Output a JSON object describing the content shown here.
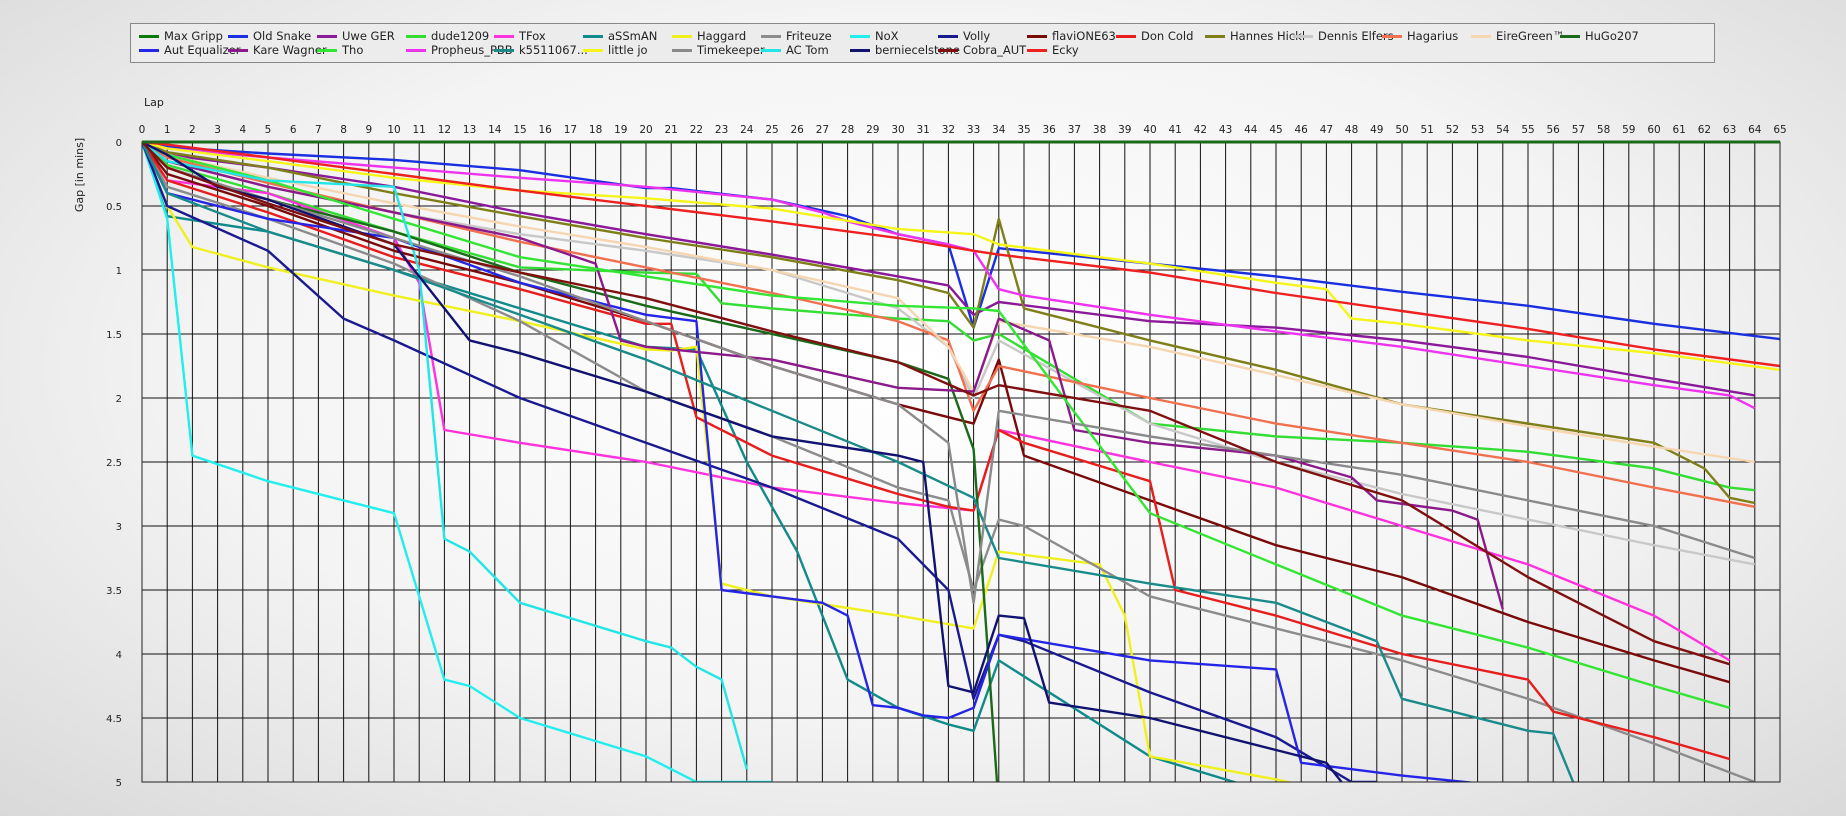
{
  "chart_data": {
    "type": "line",
    "title": "",
    "xlabel": "Lap",
    "ylabel": "Gap [in mins]",
    "xlim": [
      0,
      65
    ],
    "ylim": [
      0,
      5
    ],
    "y_inverted": true,
    "grid": true,
    "legend_position": "top",
    "x_ticks": [
      0,
      1,
      2,
      3,
      4,
      5,
      6,
      7,
      8,
      9,
      10,
      11,
      12,
      13,
      14,
      15,
      16,
      17,
      18,
      19,
      20,
      21,
      22,
      23,
      24,
      25,
      26,
      27,
      28,
      29,
      30,
      31,
      32,
      33,
      34,
      35,
      36,
      37,
      38,
      39,
      40,
      41,
      42,
      43,
      44,
      45,
      46,
      47,
      48,
      49,
      50,
      51,
      52,
      53,
      54,
      55,
      56,
      57,
      58,
      59,
      60,
      61,
      62,
      63,
      64,
      65
    ],
    "y_ticks": [
      0,
      0.5,
      1,
      1.5,
      2,
      2.5,
      3,
      3.5,
      4,
      4.5,
      5
    ],
    "y_tick_labels": [
      "0",
      "0.5",
      "1",
      "1.5",
      "2",
      "2.5",
      "3",
      "3.5",
      "4",
      "4.5",
      "5"
    ],
    "series": [
      {
        "name": "Max Gripp",
        "color": "#0a7a0a",
        "x": [
          0,
          65
        ],
        "y": [
          0,
          0
        ]
      },
      {
        "name": "Old Snake",
        "color": "#1a2fe0",
        "x": [
          0,
          1,
          5,
          10,
          15,
          20,
          21,
          25,
          28,
          30,
          32,
          33,
          34,
          40,
          45,
          50,
          55,
          60,
          65
        ],
        "y": [
          0,
          0.04,
          0.09,
          0.14,
          0.22,
          0.36,
          0.36,
          0.45,
          0.58,
          0.72,
          0.8,
          1.45,
          0.83,
          0.95,
          1.05,
          1.17,
          1.28,
          1.42,
          1.54
        ]
      },
      {
        "name": "Uwe GER",
        "color": "#8b1a9a",
        "x": [
          0,
          1,
          5,
          10,
          15,
          20,
          25,
          30,
          32,
          33,
          34,
          40,
          45,
          50,
          55,
          60,
          64
        ],
        "y": [
          0,
          0.1,
          0.2,
          0.35,
          0.55,
          0.72,
          0.88,
          1.05,
          1.12,
          1.35,
          1.25,
          1.4,
          1.45,
          1.55,
          1.68,
          1.85,
          1.98
        ]
      },
      {
        "name": "dude1209",
        "color": "#33dd33",
        "x": [
          0,
          1,
          5,
          10,
          15,
          20,
          22,
          23,
          25,
          30,
          32,
          33,
          34,
          40,
          45,
          50,
          55,
          60,
          63,
          64
        ],
        "y": [
          0,
          0.18,
          0.4,
          0.7,
          0.98,
          1.02,
          1.03,
          1.26,
          1.3,
          1.38,
          1.4,
          1.55,
          1.5,
          2.2,
          2.3,
          2.35,
          2.42,
          2.55,
          2.7,
          2.72
        ]
      },
      {
        "name": "TFox",
        "color": "#ff33dd",
        "x": [
          0,
          1,
          5,
          10,
          11,
          12,
          15,
          20,
          25,
          30,
          33,
          34,
          40,
          45,
          50,
          55,
          60,
          63
        ],
        "y": [
          0,
          0.3,
          0.4,
          0.75,
          1.1,
          2.25,
          2.35,
          2.5,
          2.7,
          2.82,
          2.88,
          2.25,
          2.5,
          2.7,
          3.0,
          3.3,
          3.7,
          4.05
        ]
      },
      {
        "name": "aSSmAN",
        "color": "#108a8a",
        "x": [
          0,
          1,
          5,
          10,
          15,
          20,
          22,
          24,
          26,
          28,
          30,
          32,
          33,
          34,
          40,
          45,
          48,
          49,
          50,
          55,
          56,
          57,
          58
        ],
        "y": [
          0,
          0.58,
          0.7,
          1.0,
          1.3,
          1.6,
          1.62,
          2.5,
          3.2,
          4.2,
          4.42,
          4.55,
          4.6,
          4.05,
          4.8,
          5.1,
          5.2,
          5.2,
          5.2,
          5.2,
          5.2,
          5.2,
          5.2
        ]
      },
      {
        "name": "Haggard",
        "color": "#f0f020",
        "x": [
          0,
          1,
          2,
          5,
          10,
          15,
          20,
          21,
          22,
          23,
          25,
          30,
          33,
          34,
          38,
          39,
          40,
          45,
          50
        ],
        "y": [
          0,
          0.5,
          0.82,
          0.98,
          1.2,
          1.4,
          1.62,
          1.63,
          1.6,
          3.45,
          3.55,
          3.7,
          3.8,
          3.2,
          3.3,
          3.7,
          4.8,
          4.98,
          5.2
        ]
      },
      {
        "name": "Friteuze",
        "color": "#8c8c8c",
        "x": [
          0,
          1,
          5,
          10,
          15,
          20,
          25,
          30,
          32,
          33,
          34,
          35,
          40,
          45,
          50,
          55,
          60,
          64
        ],
        "y": [
          0,
          0.35,
          0.6,
          0.95,
          1.4,
          1.95,
          2.3,
          2.7,
          2.8,
          3.5,
          2.95,
          3.0,
          3.55,
          3.8,
          4.05,
          4.35,
          4.7,
          5.0
        ]
      },
      {
        "name": "NoX",
        "color": "#22eeee",
        "x": [
          0,
          1,
          2,
          5,
          10,
          12,
          13,
          15,
          20,
          22,
          23,
          24,
          25
        ],
        "y": [
          0,
          0.6,
          2.45,
          2.65,
          2.9,
          4.2,
          4.25,
          4.5,
          4.8,
          5.0,
          5.0,
          5.0,
          5.0
        ]
      },
      {
        "name": "Volly",
        "color": "#1a1a90",
        "x": [
          0,
          1,
          5,
          8,
          10,
          15,
          20,
          25,
          30,
          32,
          33,
          34,
          35,
          40,
          45,
          48,
          49
        ],
        "y": [
          0,
          0.5,
          0.85,
          1.38,
          1.55,
          2.0,
          2.35,
          2.7,
          3.1,
          3.5,
          4.35,
          3.85,
          3.9,
          4.3,
          4.65,
          5.0,
          5.0
        ]
      },
      {
        "name": "flaviONE63",
        "color": "#7a0a0a",
        "x": [
          0,
          1,
          5,
          10,
          15,
          20,
          25,
          30,
          33,
          34,
          35,
          40,
          45,
          50,
          55,
          60,
          63
        ],
        "y": [
          0,
          0.25,
          0.5,
          0.85,
          1.1,
          1.4,
          1.75,
          2.05,
          2.2,
          1.7,
          2.45,
          2.8,
          3.15,
          3.4,
          3.75,
          4.05,
          4.22
        ]
      },
      {
        "name": "Don Cold",
        "color": "#e61e1e",
        "x": [
          0,
          1,
          5,
          10,
          15,
          20,
          21,
          22,
          25,
          30,
          32,
          33,
          34,
          35,
          40,
          41,
          45,
          50,
          55,
          56,
          60,
          63
        ],
        "y": [
          0,
          0.3,
          0.55,
          0.9,
          1.15,
          1.42,
          1.42,
          2.15,
          2.45,
          2.75,
          2.85,
          2.88,
          2.25,
          2.35,
          2.65,
          3.5,
          3.7,
          4.0,
          4.2,
          4.45,
          4.65,
          4.82
        ]
      },
      {
        "name": "Hannes Hickl",
        "color": "#7f7f1a",
        "x": [
          0,
          1,
          5,
          10,
          15,
          20,
          25,
          30,
          32,
          33,
          34,
          35,
          40,
          45,
          50,
          55,
          60,
          62,
          63,
          64
        ],
        "y": [
          0,
          0.08,
          0.2,
          0.4,
          0.58,
          0.75,
          0.9,
          1.08,
          1.18,
          1.45,
          0.6,
          1.3,
          1.55,
          1.78,
          2.05,
          2.2,
          2.35,
          2.55,
          2.78,
          2.82
        ]
      },
      {
        "name": "Dennis Elfers",
        "color": "#c8c8c8",
        "x": [
          0,
          1,
          5,
          10,
          15,
          20,
          25,
          30,
          32,
          33,
          34,
          40,
          45,
          50,
          55,
          60,
          64
        ],
        "y": [
          0,
          0.15,
          0.35,
          0.55,
          0.72,
          0.85,
          1.0,
          1.3,
          1.6,
          2.0,
          1.55,
          2.2,
          2.5,
          2.75,
          2.95,
          3.15,
          3.3
        ]
      },
      {
        "name": "Hagarius",
        "color": "#f07050",
        "x": [
          0,
          1,
          5,
          10,
          15,
          20,
          25,
          30,
          32,
          33,
          34,
          40,
          45,
          50,
          55,
          60,
          64
        ],
        "y": [
          0,
          0.12,
          0.32,
          0.55,
          0.78,
          0.98,
          1.18,
          1.4,
          1.55,
          2.1,
          1.75,
          2.0,
          2.2,
          2.35,
          2.5,
          2.7,
          2.85
        ]
      },
      {
        "name": "EireGreen™",
        "color": "#f5d6b0",
        "x": [
          0,
          1,
          5,
          10,
          15,
          20,
          25,
          30,
          32,
          33,
          34,
          40,
          45,
          50,
          55,
          60,
          64
        ],
        "y": [
          0,
          0.1,
          0.28,
          0.48,
          0.66,
          0.82,
          1.0,
          1.22,
          1.6,
          1.95,
          1.4,
          1.6,
          1.82,
          2.05,
          2.22,
          2.38,
          2.5
        ]
      },
      {
        "name": "HuGo207",
        "color": "#1a6a1a",
        "x": [
          0,
          1,
          5,
          10,
          15,
          20,
          25,
          30,
          32,
          33,
          34
        ],
        "y": [
          0,
          0.2,
          0.45,
          0.7,
          1.02,
          1.28,
          1.5,
          1.72,
          1.85,
          2.4,
          5.2
        ]
      },
      {
        "name": "Aut Equalizer",
        "color": "#2525e6",
        "x": [
          0,
          1,
          5,
          10,
          15,
          20,
          22,
          23,
          25,
          27,
          28,
          29,
          30,
          31,
          32,
          33,
          34,
          40,
          45,
          46,
          50,
          55
        ],
        "y": [
          0,
          0.4,
          0.6,
          0.75,
          1.1,
          1.35,
          1.4,
          3.5,
          3.55,
          3.6,
          3.7,
          4.4,
          4.42,
          4.48,
          4.5,
          4.42,
          3.85,
          4.05,
          4.12,
          4.85,
          4.95,
          5.05
        ]
      },
      {
        "name": "Kare Wagner",
        "color": "#8b1a8b",
        "x": [
          0,
          1,
          5,
          10,
          15,
          18,
          19,
          20,
          25,
          30,
          33,
          34,
          36,
          37,
          40,
          45,
          48,
          49,
          52,
          53,
          54
        ],
        "y": [
          0,
          0.15,
          0.35,
          0.55,
          0.75,
          0.95,
          1.55,
          1.6,
          1.7,
          1.92,
          1.95,
          1.38,
          1.55,
          2.25,
          2.35,
          2.45,
          2.62,
          2.8,
          2.88,
          2.95,
          3.65
        ]
      },
      {
        "name": "Tho",
        "color": "#33e633",
        "x": [
          0,
          1,
          5,
          10,
          15,
          20,
          25,
          30,
          33,
          34,
          40,
          45,
          50,
          55,
          60,
          63
        ],
        "y": [
          0,
          0.1,
          0.3,
          0.6,
          0.9,
          1.05,
          1.2,
          1.28,
          1.3,
          1.32,
          2.9,
          3.3,
          3.7,
          3.95,
          4.25,
          4.42
        ]
      },
      {
        "name": "Propheus_PBB",
        "color": "#ee33ee",
        "x": [
          0,
          1,
          5,
          10,
          15,
          20,
          25,
          27,
          28,
          30,
          32,
          33,
          34,
          35,
          40,
          45,
          50,
          55,
          60,
          63,
          64
        ],
        "y": [
          0,
          0.05,
          0.12,
          0.2,
          0.28,
          0.35,
          0.45,
          0.55,
          0.62,
          0.72,
          0.8,
          0.85,
          1.15,
          1.2,
          1.35,
          1.48,
          1.6,
          1.75,
          1.9,
          1.98,
          2.08
        ]
      },
      {
        "name": "k5511067...",
        "color": "#1a8a8a",
        "x": [
          0,
          1,
          5,
          10,
          15,
          20,
          25,
          30,
          33,
          34,
          40,
          45,
          49,
          50,
          55,
          56,
          57
        ],
        "y": [
          0,
          0.4,
          0.7,
          1.0,
          1.35,
          1.7,
          2.1,
          2.5,
          2.78,
          3.25,
          3.45,
          3.6,
          3.9,
          4.35,
          4.6,
          4.62,
          5.1
        ]
      },
      {
        "name": "little jo",
        "color": "#f5f51a",
        "x": [
          0,
          1,
          5,
          10,
          15,
          20,
          25,
          30,
          33,
          34,
          40,
          45,
          47,
          48,
          50,
          55,
          60,
          65
        ],
        "y": [
          0,
          0.05,
          0.15,
          0.28,
          0.38,
          0.44,
          0.52,
          0.68,
          0.72,
          0.8,
          0.95,
          1.1,
          1.15,
          1.38,
          1.42,
          1.55,
          1.65,
          1.78
        ]
      },
      {
        "name": "Timekeeper",
        "color": "#8a8a8a",
        "x": [
          0,
          1,
          5,
          10,
          15,
          20,
          25,
          30,
          32,
          33,
          34,
          40,
          45,
          50,
          55,
          60,
          64
        ],
        "y": [
          0,
          0.2,
          0.45,
          0.75,
          1.05,
          1.4,
          1.75,
          2.05,
          2.35,
          3.6,
          2.1,
          2.3,
          2.45,
          2.6,
          2.8,
          3.0,
          3.25
        ]
      },
      {
        "name": "AC Tom",
        "color": "#22e6e6",
        "x": [
          0,
          1,
          5,
          10,
          11,
          12,
          13,
          15,
          20,
          21,
          22,
          23,
          24
        ],
        "y": [
          0,
          0.15,
          0.3,
          0.35,
          1.0,
          3.1,
          3.2,
          3.6,
          3.9,
          3.95,
          4.1,
          4.2,
          4.9
        ]
      },
      {
        "name": "berniecelstone",
        "color": "#121270",
        "x": [
          0,
          1,
          3,
          5,
          10,
          12,
          13,
          15,
          20,
          25,
          30,
          31,
          32,
          33,
          34,
          35,
          36,
          40,
          45,
          47,
          48
        ],
        "y": [
          0,
          0.1,
          0.35,
          0.45,
          0.8,
          1.3,
          1.55,
          1.65,
          1.95,
          2.3,
          2.45,
          2.5,
          4.25,
          4.3,
          3.7,
          3.72,
          4.38,
          4.5,
          4.75,
          4.85,
          5.1
        ]
      },
      {
        "name": "Cobra_AUT",
        "color": "#801010",
        "x": [
          0,
          1,
          5,
          10,
          15,
          20,
          25,
          30,
          33,
          34,
          40,
          45,
          50,
          55,
          60,
          63
        ],
        "y": [
          0,
          0.2,
          0.48,
          0.8,
          1.02,
          1.22,
          1.48,
          1.72,
          1.98,
          1.9,
          2.1,
          2.5,
          2.8,
          3.4,
          3.9,
          4.08
        ]
      },
      {
        "name": "Ecky",
        "color": "#ee2020",
        "x": [
          0,
          1,
          5,
          10,
          15,
          20,
          25,
          30,
          33,
          34,
          40,
          45,
          50,
          55,
          60,
          65
        ],
        "y": [
          0,
          0.02,
          0.12,
          0.25,
          0.38,
          0.5,
          0.62,
          0.75,
          0.85,
          0.88,
          1.02,
          1.18,
          1.32,
          1.46,
          1.62,
          1.75
        ]
      }
    ]
  }
}
